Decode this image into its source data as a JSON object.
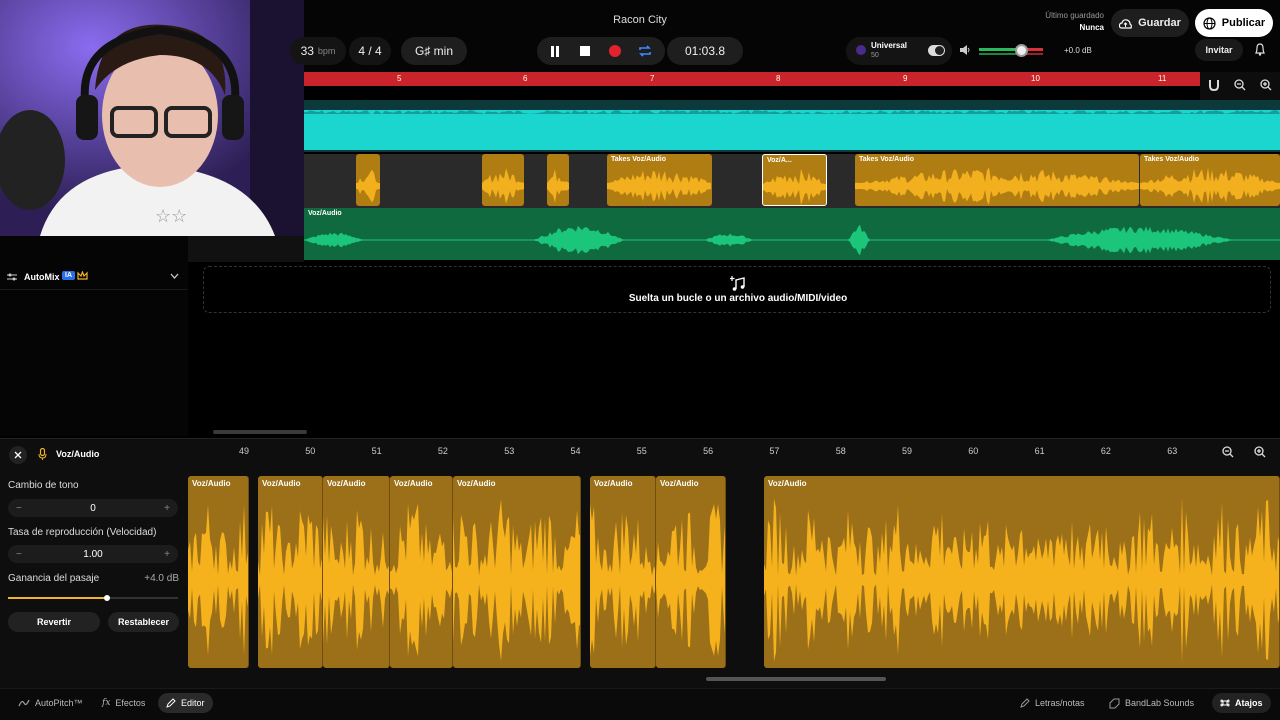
{
  "header": {
    "project_title": "Racon City",
    "bpm_value": "33",
    "bpm_unit": "bpm",
    "time_signature": "4 / 4",
    "key": "G♯ min",
    "time_display": "01:03.8",
    "last_saved_label": "Último guardado",
    "last_saved_value": "Nunca",
    "save_label": "Guardar",
    "publish_label": "Publicar",
    "invite_label": "Invitar",
    "master_effect_name": "Universal",
    "master_effect_value": "50",
    "volume_db": "+0.0 dB"
  },
  "ruler": {
    "numbers": [
      "5",
      "6",
      "7",
      "8",
      "9",
      "10",
      "11"
    ]
  },
  "tracks": {
    "track2_clips": [
      {
        "label": ""
      },
      {
        "label": ""
      },
      {
        "label": ""
      },
      {
        "label": "Takes  Voz/Audio"
      },
      {
        "label": "Voz/A..."
      },
      {
        "label": "Takes  Voz/Audio"
      },
      {
        "label": "Takes  Voz/Audio"
      }
    ],
    "track3_label": "Voz/Audio"
  },
  "left_panel": {
    "automix_label": "AutoMix",
    "ai_badge": "IA"
  },
  "dropzone": {
    "text": "Suelta un bucle o un archivo audio/MIDI/video"
  },
  "editor": {
    "track_name": "Voz/Audio",
    "pitch_label": "Cambio de tono",
    "pitch_value": "0",
    "rate_label": "Tasa de reproducción (Velocidad)",
    "rate_value": "1.00",
    "gain_label": "Ganancia del pasaje",
    "gain_value": "+4.0 dB",
    "gain_level": 0.58,
    "revert_label": "Revertir",
    "reset_label": "Restablecer",
    "ruler_numbers": [
      "49",
      "50",
      "51",
      "52",
      "53",
      "54",
      "55",
      "56",
      "57",
      "58",
      "59",
      "60",
      "61",
      "62",
      "63"
    ],
    "clip_labels": [
      "Voz/Audio",
      "Voz/Audio",
      "Voz/Audio",
      "Voz/Audio",
      "Voz/Audio",
      "Voz/Audio",
      "Voz/Audio",
      "Voz/Audio"
    ]
  },
  "bottom_bar": {
    "autopitch_label": "AutoPitch™",
    "effects_label": "Efectos",
    "editor_label": "Editor",
    "lyrics_label": "Letras/notas",
    "sounds_label": "BandLab Sounds",
    "shortcuts_label": "Atajos"
  },
  "colors": {
    "accent_red": "#c9232c",
    "track1_color": "#1ad6cf",
    "track2_color": "#f2b01e",
    "track3_color": "#1bc67a"
  }
}
